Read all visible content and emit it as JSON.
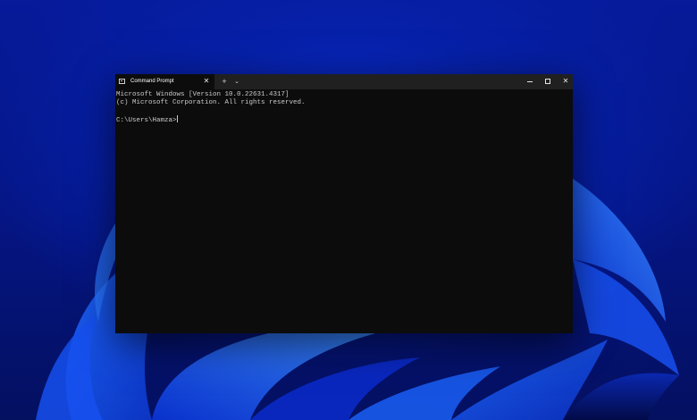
{
  "desktop": {
    "wallpaper_icon": "windows-bloom-wallpaper"
  },
  "window": {
    "tab_title": "Command Prompt",
    "tab_icon": "terminal-icon",
    "tab_close_glyph": "✕",
    "new_tab_glyph": "+",
    "dropdown_glyph": "⌄",
    "minimize_icon": "minimize-icon",
    "maximize_icon": "maximize-icon",
    "close_glyph": "✕"
  },
  "console": {
    "lines": [
      "Microsoft Windows [Version 10.0.22631.4317]",
      "(c) Microsoft Corporation. All rights reserved.",
      "",
      "C:\\Users\\Hamza>"
    ]
  },
  "colors": {
    "console_background": "#0c0c0c",
    "console_text": "#cccccc",
    "titlebar": "#202020",
    "wallpaper_blue": "#0620a8"
  }
}
